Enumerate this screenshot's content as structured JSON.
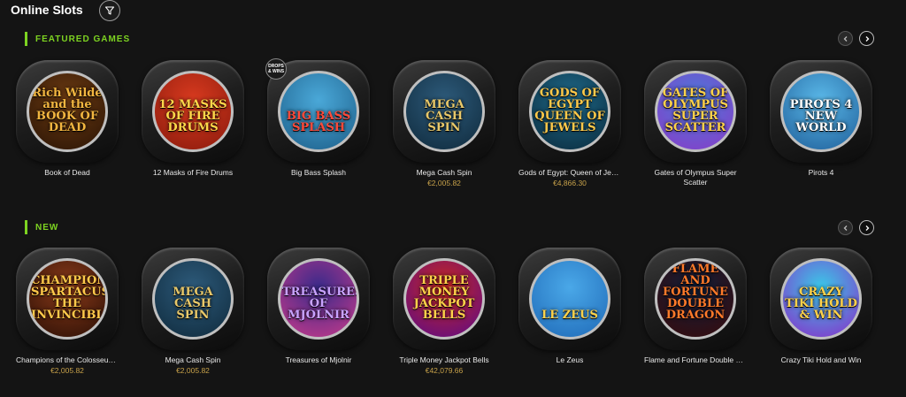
{
  "header": {
    "title": "Online Slots",
    "filter_icon": "filter-funnel-icon"
  },
  "sections": [
    {
      "label": "FEATURED GAMES",
      "accent": "#7dd321",
      "games": [
        {
          "name": "Book of Dead",
          "jackpot": "",
          "logo": "Rich Wilde and the BOOK OF DEAD",
          "colors": [
            "#6b3a12",
            "#2a1405"
          ],
          "logo_color": "#f2b640",
          "badge": ""
        },
        {
          "name": "12 Masks of Fire Drums",
          "jackpot": "",
          "logo": "12 MASKS OF FIRE DRUMS",
          "colors": [
            "#d83a1f",
            "#8a1a0c"
          ],
          "logo_color": "#ffd84a",
          "badge": ""
        },
        {
          "name": "Big Bass Splash",
          "jackpot": "",
          "logo": "BIG BASS SPLASH",
          "colors": [
            "#4aa8d8",
            "#1d5f8a"
          ],
          "logo_color": "#ff4a3a",
          "badge": "DROPS & WINS"
        },
        {
          "name": "Mega Cash Spin",
          "jackpot": "€2,005.82",
          "logo": "MEGA CASH SPIN",
          "colors": [
            "#2d5a7a",
            "#0f2a3c"
          ],
          "logo_color": "#e8c86a",
          "badge": ""
        },
        {
          "name": "Gods of Egypt: Queen of Jewels",
          "jackpot": "€4,866.30",
          "logo": "GODS OF EGYPT QUEEN OF JEWELS",
          "colors": [
            "#1f6a8a",
            "#0a2a3c"
          ],
          "logo_color": "#ffc94a",
          "badge": ""
        },
        {
          "name": "Gates of Olympus Super Scatter",
          "jackpot": "",
          "logo": "GATES OF OLYMPUS SUPER SCATTER",
          "colors": [
            "#4a7ad8",
            "#8a3ac8"
          ],
          "logo_color": "#ffd24a",
          "badge": ""
        },
        {
          "name": "Pirots 4",
          "jackpot": "",
          "logo": "PIROTS 4 NEW WORLD",
          "colors": [
            "#5ab8e8",
            "#1f5f9a"
          ],
          "logo_color": "#ffffff",
          "badge": ""
        }
      ]
    },
    {
      "label": "NEW",
      "accent": "#7dd321",
      "games": [
        {
          "name": "Champions of the Colosseum: Spartacus the Invincible",
          "jackpot": "€2,005.82",
          "logo": "CHAMPIONS SPARTACUS THE INVINCIBLE",
          "colors": [
            "#8a3a1a",
            "#2a0f05"
          ],
          "logo_color": "#ffc94a",
          "badge": ""
        },
        {
          "name": "Mega Cash Spin",
          "jackpot": "€2,005.82",
          "logo": "MEGA CASH SPIN",
          "colors": [
            "#2d5a7a",
            "#0f2a3c"
          ],
          "logo_color": "#e8c86a",
          "badge": ""
        },
        {
          "name": "Treasures of Mjolnir",
          "jackpot": "",
          "logo": "TREASURES OF MJOLNIR",
          "colors": [
            "#3a2a8a",
            "#c83a8a"
          ],
          "logo_color": "#c8a2ff",
          "badge": ""
        },
        {
          "name": "Triple Money Jackpot Bells",
          "jackpot": "€42,079.66",
          "logo": "TRIPLE MONEY JACKPOT BELLS",
          "colors": [
            "#c8281f",
            "#5a0a8a"
          ],
          "logo_color": "#ffd24a",
          "badge": ""
        },
        {
          "name": "Le Zeus",
          "jackpot": "",
          "logo": "LE ZEUS",
          "colors": [
            "#4aa8e8",
            "#1f6ab8"
          ],
          "logo_color": "#ffd24a",
          "badge": ""
        },
        {
          "name": "Flame and Fortune Double Dragon",
          "jackpot": "",
          "logo": "FLAME AND FORTUNE DOUBLE DRAGON",
          "colors": [
            "#0f1f3a",
            "#3a0a0a"
          ],
          "logo_color": "#ff7a2a",
          "badge": ""
        },
        {
          "name": "Crazy Tiki Hold and Win",
          "jackpot": "",
          "logo": "CRAZY TIKI HOLD & WIN",
          "colors": [
            "#3ac8e8",
            "#8a2ac8"
          ],
          "logo_color": "#ffd24a",
          "badge": ""
        }
      ]
    }
  ],
  "carousel": {
    "prev_icon": "chevron-left-icon",
    "next_icon": "chevron-right-icon"
  }
}
